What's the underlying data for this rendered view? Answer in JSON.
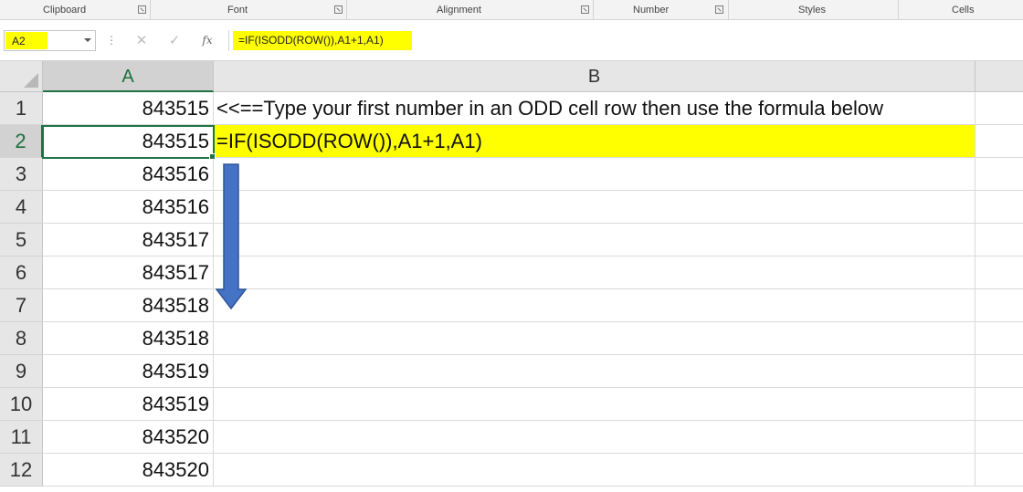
{
  "ribbon_groups": [
    {
      "label": "Clipboard"
    },
    {
      "label": "Font"
    },
    {
      "label": "Alignment"
    },
    {
      "label": "Number"
    },
    {
      "label": "Styles"
    },
    {
      "label": "Cells"
    }
  ],
  "formula_bar": {
    "name_box": "A2",
    "cancel_icon": "✕",
    "enter_icon": "✓",
    "fx_label": "fx",
    "formula": "=IF(ISODD(ROW()),A1+1,A1)"
  },
  "columns": [
    "A",
    "B"
  ],
  "rows": [
    {
      "num": "1",
      "a": "843515",
      "b": "<<==Type your first number in an ODD cell row then use the formula below"
    },
    {
      "num": "2",
      "a": "843515",
      "b": "=IF(ISODD(ROW()),A1+1,A1)"
    },
    {
      "num": "3",
      "a": "843516",
      "b": ""
    },
    {
      "num": "4",
      "a": "843516",
      "b": ""
    },
    {
      "num": "5",
      "a": "843517",
      "b": ""
    },
    {
      "num": "6",
      "a": "843517",
      "b": ""
    },
    {
      "num": "7",
      "a": "843518",
      "b": ""
    },
    {
      "num": "8",
      "a": "843518",
      "b": ""
    },
    {
      "num": "9",
      "a": "843519",
      "b": ""
    },
    {
      "num": "10",
      "a": "843519",
      "b": ""
    },
    {
      "num": "11",
      "a": "843520",
      "b": ""
    },
    {
      "num": "12",
      "a": "843520",
      "b": ""
    }
  ],
  "colors": {
    "highlight": "#ffff00",
    "selection": "#217346",
    "arrow": "#4472c4"
  }
}
